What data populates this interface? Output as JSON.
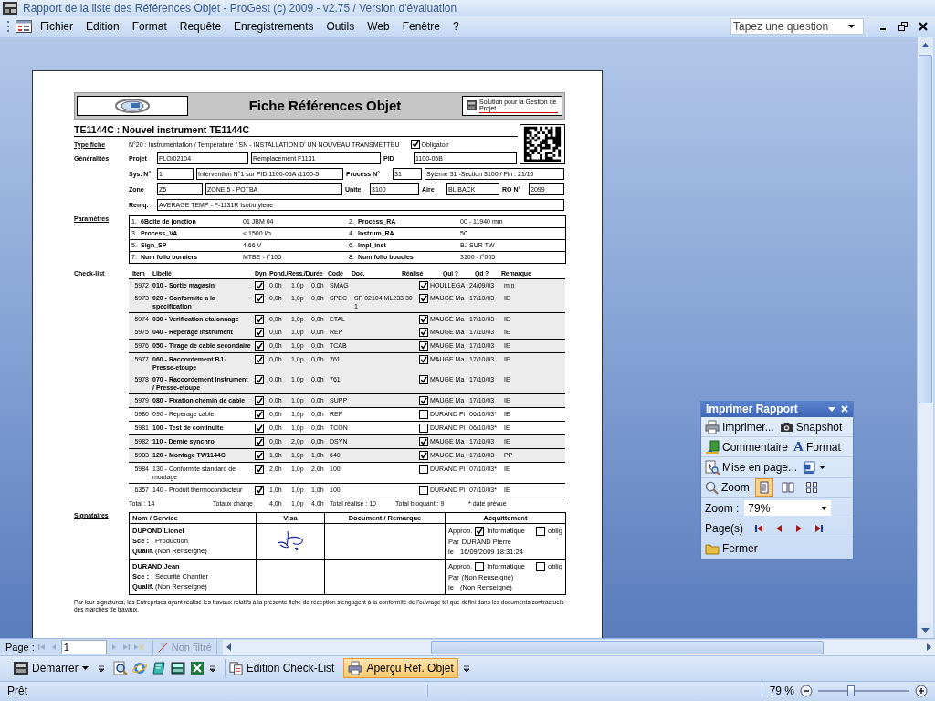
{
  "window": {
    "title": "Rapport de la liste des Références Objet - ProGest (c) 2009 - v2.75 / Version d'évaluation"
  },
  "menu": [
    "Fichier",
    "Edition",
    "Format",
    "Requête",
    "Enregistrements",
    "Outils",
    "Web",
    "Fenêtre",
    "?"
  ],
  "help_search": {
    "placeholder": "Tapez une question"
  },
  "report": {
    "title": "Fiche Références Objet",
    "brand_tagline": "Solution pour la Gestion de Projet",
    "object_title": "TE1144C : Nouvel instrument TE1144C",
    "type_fiche": {
      "label": "Type fiche",
      "value": "N°20 : Instrumentation / Température / SN - INSTALLATION D' UN NOUVEAU TRANSMETTEU",
      "mandatory_label": "Obligatoir",
      "mandatory": true
    },
    "generalites": {
      "label": "Généralités",
      "lines": [
        [
          {
            "kind": "label",
            "text": "Projet"
          },
          {
            "kind": "box",
            "text": "FLO/02104"
          },
          {
            "kind": "box",
            "text": "Remplacement F1131"
          },
          {
            "kind": "label",
            "text": "PID"
          },
          {
            "kind": "box",
            "text": "1100-05B"
          }
        ],
        [
          {
            "kind": "label",
            "text": "Sys. N°"
          },
          {
            "kind": "box",
            "text": "1"
          },
          {
            "kind": "box",
            "text": "Intervention N°1 sur PID 1100-05A /1100-5"
          },
          {
            "kind": "label",
            "text": "Process N°"
          },
          {
            "kind": "box",
            "text": "31"
          },
          {
            "kind": "box",
            "text": "Syteme 31 -Section 3100 / Fin : 21/10"
          }
        ],
        [
          {
            "kind": "label",
            "text": "Zone"
          },
          {
            "kind": "box",
            "text": "Z5"
          },
          {
            "kind": "box",
            "text": "ZONE 5 - POTBA"
          },
          {
            "kind": "label",
            "text": "Unite"
          },
          {
            "kind": "box",
            "text": "3100"
          },
          {
            "kind": "label",
            "text": "Aire"
          },
          {
            "kind": "box",
            "text": "BL BACK"
          },
          {
            "kind": "label",
            "text": "RO N°"
          },
          {
            "kind": "box",
            "text": "2099"
          }
        ],
        [
          {
            "kind": "label",
            "text": "Remq."
          },
          {
            "kind": "box",
            "text": "AVERAGE TEMP - F-1131R Isobutylene"
          }
        ]
      ]
    },
    "parametres": {
      "label": "Paramètres",
      "items": [
        {
          "num": "1.",
          "name": "6Boite de jonction",
          "value": "01 JBM 04"
        },
        {
          "num": "2.",
          "name": "Process_RA",
          "value": "00 - 11940 mm"
        },
        {
          "num": "3.",
          "name": "Process_VA",
          "value": "< 1500 l/h"
        },
        {
          "num": "4.",
          "name": "Instrum_RA",
          "value": "50"
        },
        {
          "num": "5.",
          "name": "Sign_SP",
          "value": "4.66 V"
        },
        {
          "num": "6.",
          "name": "Impl_inst",
          "value": "BJ SUR TW"
        },
        {
          "num": "7.",
          "name": "Num folio borniers",
          "value": "MTBE - f°105"
        },
        {
          "num": "8.",
          "name": "Num folio boucles",
          "value": "3100 - f°005"
        }
      ]
    },
    "checklist": {
      "label": "Check-list",
      "columns": [
        "Item",
        "Libellé",
        "Dyn",
        "Pond./Ress./Durée",
        "Code",
        "Doc.",
        "Réalisé",
        "Qui ?",
        "Qd ?",
        "Remarque"
      ],
      "groups": [
        {
          "shaded": true,
          "rows": [
            {
              "item": "5972",
              "label": "010 - Sortie magasin",
              "bold": true,
              "dyn": true,
              "pond": "0,0h",
              "ress": "1,0p",
              "duree": "0,0h",
              "code": "SMAG",
              "realise": true,
              "qui": "HOULLEGA",
              "qd": "24/09/03",
              "remarque": "min"
            },
            {
              "item": "5973",
              "label": "020 - Conformite a la specification",
              "bold": true,
              "dyn": true,
              "pond": "0,0h",
              "ress": "1,0p",
              "duree": "0,0h",
              "code": "SPEC",
              "doc": "SP 02104 ML233 301",
              "realise": true,
              "qui": "MAUGE Ma",
              "qd": "17/10/03",
              "remarque": "IE"
            }
          ]
        },
        {
          "shaded": true,
          "rows": [
            {
              "item": "5974",
              "label": "030 - Verification etalonnage",
              "bold": true,
              "dyn": true,
              "pond": "0,0h",
              "ress": "1,0p",
              "duree": "0,0h",
              "code": "ETAL",
              "realise": true,
              "qui": "MAUGE Ma",
              "qd": "17/10/03",
              "remarque": "IE"
            },
            {
              "item": "5975",
              "label": "040 - Reperage instrument",
              "bold": true,
              "dyn": true,
              "pond": "0,0h",
              "ress": "1,0p",
              "duree": "0,0h",
              "code": "REP",
              "realise": true,
              "qui": "MAUGE Ma",
              "qd": "17/10/03",
              "remarque": "IE"
            }
          ]
        },
        {
          "shaded": true,
          "rows": [
            {
              "item": "5976",
              "label": "050 - Tirage de cable secondaire",
              "bold": true,
              "dyn": true,
              "pond": "0,0h",
              "ress": "1,0p",
              "duree": "0,0h",
              "code": "TCAB",
              "realise": true,
              "qui": "MAUGE Ma",
              "qd": "17/10/03",
              "remarque": "IE"
            }
          ]
        },
        {
          "shaded": true,
          "rows": [
            {
              "item": "5977",
              "label": "060 - Raccordement BJ / Presse-etoupe",
              "bold": true,
              "dyn": true,
              "pond": "0,0h",
              "ress": "1,0p",
              "duree": "0,0h",
              "code": "761",
              "realise": true,
              "qui": "MAUGE Ma",
              "qd": "17/10/03",
              "remarque": "IE"
            },
            {
              "item": "5978",
              "label": "070 - Raccordement instrument / Presse-etoupe",
              "bold": true,
              "dyn": true,
              "pond": "0,0h",
              "ress": "1,0p",
              "duree": "0,0h",
              "code": "761",
              "realise": true,
              "qui": "MAUGE Ma",
              "qd": "17/10/03",
              "remarque": "IE"
            }
          ]
        },
        {
          "shaded": true,
          "rows": [
            {
              "item": "5979",
              "label": "080 - Fixation chemin de cable",
              "bold": true,
              "dyn": true,
              "pond": "0,0h",
              "ress": "1,0p",
              "duree": "0,0h",
              "code": "SUPP",
              "realise": true,
              "qui": "MAUGE Ma",
              "qd": "17/10/03",
              "remarque": "IE"
            }
          ]
        },
        {
          "shaded": false,
          "rows": [
            {
              "item": "5980",
              "label": "090 - Reperage cable",
              "bold": false,
              "dyn": true,
              "pond": "0,0h",
              "ress": "1,0p",
              "duree": "0,0h",
              "code": "REP",
              "realise": false,
              "qui": "DURAND Pi",
              "qd": "06/10/03*",
              "remarque": "IE"
            }
          ]
        },
        {
          "shaded": false,
          "rows": [
            {
              "item": "5981",
              "label": "100 - Test de continuite",
              "bold": true,
              "dyn": true,
              "pond": "0,0h",
              "ress": "1,0p",
              "duree": "0,0h",
              "code": "TCON",
              "realise": false,
              "qui": "DURAND Pi",
              "qd": "06/10/03*",
              "remarque": "IE"
            }
          ]
        },
        {
          "shaded": true,
          "rows": [
            {
              "item": "5982",
              "label": "110 - Demie synchro",
              "bold": true,
              "dyn": true,
              "pond": "0,0h",
              "ress": "2,0p",
              "duree": "0,0h",
              "code": "DSYN",
              "realise": true,
              "qui": "MAUGE Ma",
              "qd": "17/10/03",
              "remarque": "IE"
            }
          ]
        },
        {
          "shaded": true,
          "rows": [
            {
              "item": "5983",
              "label": "120 - Montage TW1144C",
              "bold": true,
              "dyn": true,
              "pond": "1,0h",
              "ress": "1,0p",
              "duree": "1,0h",
              "code": "640",
              "realise": true,
              "qui": "MAUGE Ma",
              "qd": "17/10/03",
              "remarque": "PP"
            }
          ]
        },
        {
          "shaded": false,
          "rows": [
            {
              "item": "5984",
              "label": "130 - Conformite standard de montage",
              "bold": false,
              "dyn": true,
              "pond": "2,0h",
              "ress": "1,0p",
              "duree": "2,0h",
              "code": "100",
              "realise": false,
              "qui": "DURAND Pi",
              "qd": "07/10/03*",
              "remarque": "IE"
            }
          ]
        },
        {
          "shaded": false,
          "rows": [
            {
              "item": "6357",
              "label": "140 - Produit thermoconducteur",
              "bold": false,
              "dyn": true,
              "pond": "1,0h",
              "ress": "1,0p",
              "duree": "1,0h",
              "code": "100",
              "realise": false,
              "qui": "DURAND Pi",
              "qd": "07/10/03*",
              "remarque": "IE"
            }
          ]
        }
      ],
      "totals": {
        "count": "Total : 14",
        "charge_label": "Totaux charge",
        "pond": "4,0h",
        "ress": "1,0p",
        "duree": "4,0h",
        "realise": "Total réalisé : 10",
        "bloquant": "Total bloquant : 9",
        "note": "* date prévue"
      }
    },
    "signatories": {
      "label": "Signataires",
      "columns": [
        "Nom / Service",
        "Visa",
        "Document / Remarque",
        "Acquittement"
      ],
      "rows": [
        {
          "name": "DUPOND Lionel",
          "sce_label": "Sce :",
          "sce": "Production",
          "qualif_label": "Qualif.",
          "qualif": "(Non Renseigné)",
          "signed": true,
          "approb_label": "Approb.",
          "informatique_label": "Informatique",
          "informatique": true,
          "oblig_label": "oblig",
          "oblig": false,
          "par_label": "Par",
          "par": "DURAND Pierre",
          "le_label": "le",
          "le": "16/09/2009 18:31:24"
        },
        {
          "name": "DURAND Jean",
          "sce_label": "Sce :",
          "sce": "Sécurité Chantier",
          "qualif_label": "Qualif.",
          "qualif": "(Non Renseigné)",
          "signed": false,
          "approb_label": "Approb.",
          "informatique_label": "Informatique",
          "informatique": false,
          "oblig_label": "oblig",
          "oblig": false,
          "par_label": "Par",
          "par": "(Non Renseigné)",
          "le_label": "le",
          "le": "(Non Renseigné)"
        }
      ]
    },
    "footnote": "Par leur signatures, les Entreprises ayant réalisé les travaux relatifs à la présente fiche de réception s'engagent à la conformité de l'ouvrage tel que défini dans les documents contractuels des marchés de travaux."
  },
  "print_panel": {
    "title": "Imprimer Rapport",
    "print": "Imprimer...",
    "snapshot": "Snapshot",
    "comment": "Commentaire",
    "format_glyph": "A",
    "format": "Format",
    "page_setup": "Mise en page...",
    "zoom": "Zoom",
    "view_modes": [
      {
        "selected": true
      },
      {
        "selected": false
      },
      {
        "selected": false
      }
    ],
    "zoom_label": "Zoom :",
    "zoom_value": "79%",
    "pages_label": "Page(s)",
    "close": "Fermer"
  },
  "record_nav": {
    "label": "Page :",
    "value": "1",
    "filter": "Non filtré"
  },
  "taskbar": {
    "start": "Démarrer",
    "windows": [
      {
        "label": "Edition Check-List",
        "selected": false
      },
      {
        "label": "Aperçu Réf. Objet",
        "selected": true
      }
    ]
  },
  "status_bar": {
    "text": "Prêt",
    "zoom": "79 %",
    "level": 0.36
  }
}
